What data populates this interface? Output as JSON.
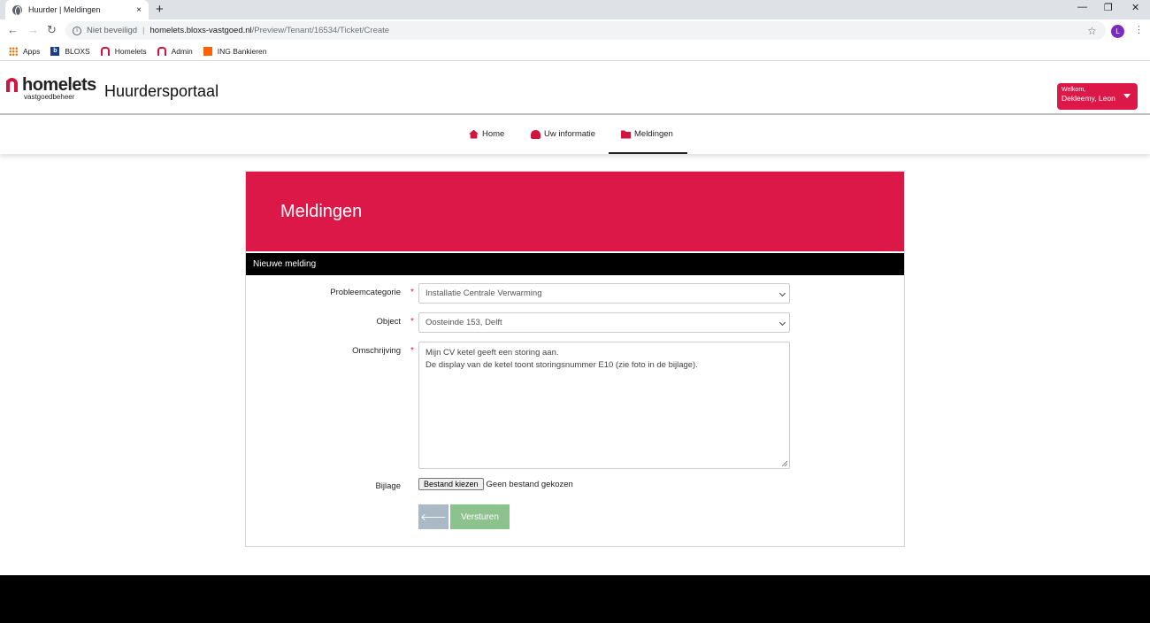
{
  "browser": {
    "tab_title": "Huurder | Meldingen",
    "tab_close": "×",
    "new_tab": "+",
    "security_label": "Niet beveiligd",
    "url_domain": "homelets.bloxs-vastgoed.nl",
    "url_path": "/Preview/Tenant/16534/Ticket/Create",
    "profile_initial": "L",
    "bookmarks": [
      {
        "label": "Apps",
        "icon": "apps-grid-icon"
      },
      {
        "label": "BLOXS",
        "icon": "bloxs-icon"
      },
      {
        "label": "Homelets",
        "icon": "homelets-icon"
      },
      {
        "label": "Admin",
        "icon": "homelets-icon"
      },
      {
        "label": "ING Bankieren",
        "icon": "ing-icon"
      }
    ]
  },
  "header": {
    "logo_word": "homelets",
    "logo_sub": "vastgoedbeheer",
    "portal_title": "Huurdersportaal",
    "welcome_line1": "Welkom,",
    "welcome_line2": "Dekleemy, Leon"
  },
  "nav": {
    "items": [
      {
        "label": "Home",
        "icon": "home-icon"
      },
      {
        "label": "Uw informatie",
        "icon": "user-icon"
      },
      {
        "label": "Meldingen",
        "icon": "folder-open-icon",
        "active": true
      }
    ]
  },
  "panel": {
    "banner_title": "Meldingen",
    "section_title": "Nieuwe melding",
    "fields": {
      "category": {
        "label": "Probleemcategorie",
        "value": "Installatie Centrale Verwarming"
      },
      "object": {
        "label": "Object",
        "value": "Oosteinde 153, Delft"
      },
      "description": {
        "label": "Omschrijving",
        "line1": "Mijn CV ketel geeft een storing aan.",
        "line2": "De display van de ketel toont storingsnummer E10 (zie foto in de bijlage)."
      },
      "attachment": {
        "label": "Bijlage",
        "button": "Bestand kiezen",
        "status": "Geen bestand gekozen"
      }
    },
    "required_mark": "*",
    "back_glyph": "🡐",
    "submit_label": "Versturen"
  },
  "colors": {
    "brand": "#dc1848",
    "back_button": "#a9b9c6",
    "submit_button": "#8cc28d"
  }
}
